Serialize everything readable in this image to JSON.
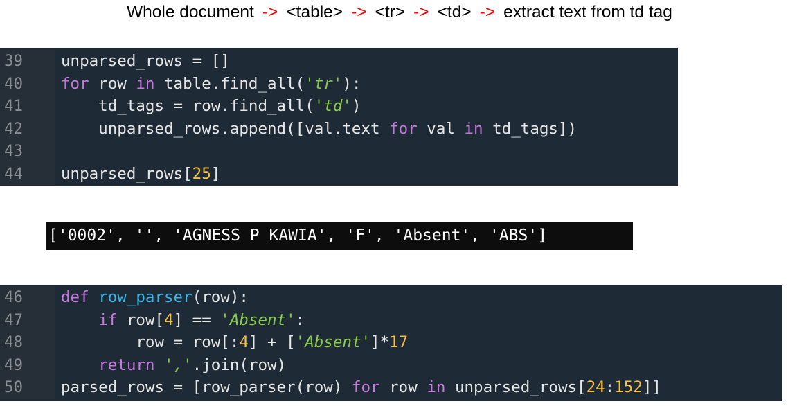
{
  "caption": {
    "steps": [
      "Whole document",
      "<table>",
      "<tr>",
      "<td>",
      "extract text from td tag"
    ],
    "arrow": "->"
  },
  "code_block_1": [
    {
      "num": "39",
      "tokens": [
        {
          "t": "plain",
          "v": "unparsed_rows = []"
        }
      ]
    },
    {
      "num": "40",
      "tokens": [
        {
          "t": "kw",
          "v": "for"
        },
        {
          "t": "plain",
          "v": " row "
        },
        {
          "t": "kw",
          "v": "in"
        },
        {
          "t": "plain",
          "v": " table.find_all("
        },
        {
          "t": "str",
          "v": "'tr'"
        },
        {
          "t": "plain",
          "v": "):"
        }
      ]
    },
    {
      "num": "41",
      "tokens": [
        {
          "t": "plain",
          "v": "    td_tags = row.find_all("
        },
        {
          "t": "str",
          "v": "'td'"
        },
        {
          "t": "plain",
          "v": ")"
        }
      ]
    },
    {
      "num": "42",
      "tokens": [
        {
          "t": "plain",
          "v": "    unparsed_rows.append([val.text "
        },
        {
          "t": "kw",
          "v": "for"
        },
        {
          "t": "plain",
          "v": " val "
        },
        {
          "t": "kw",
          "v": "in"
        },
        {
          "t": "plain",
          "v": " td_tags])"
        }
      ]
    },
    {
      "num": "43",
      "tokens": []
    },
    {
      "num": "44",
      "tokens": [
        {
          "t": "plain",
          "v": "unparsed_rows["
        },
        {
          "t": "num",
          "v": "25"
        },
        {
          "t": "plain",
          "v": "]"
        }
      ]
    }
  ],
  "output": "['0002', '', 'AGNESS P KAWIA', 'F', 'Absent', 'ABS']",
  "code_block_2": [
    {
      "num": "46",
      "tokens": [
        {
          "t": "kw",
          "v": "def"
        },
        {
          "t": "plain",
          "v": " "
        },
        {
          "t": "fn",
          "v": "row_parser"
        },
        {
          "t": "plain",
          "v": "(row):"
        }
      ]
    },
    {
      "num": "47",
      "tokens": [
        {
          "t": "plain",
          "v": "    "
        },
        {
          "t": "kw",
          "v": "if"
        },
        {
          "t": "plain",
          "v": " row["
        },
        {
          "t": "num",
          "v": "4"
        },
        {
          "t": "plain",
          "v": "] == "
        },
        {
          "t": "str",
          "v": "'Absent'"
        },
        {
          "t": "plain",
          "v": ":"
        }
      ]
    },
    {
      "num": "48",
      "tokens": [
        {
          "t": "plain",
          "v": "        row = row[:"
        },
        {
          "t": "num",
          "v": "4"
        },
        {
          "t": "plain",
          "v": "] + ["
        },
        {
          "t": "str",
          "v": "'Absent'"
        },
        {
          "t": "plain",
          "v": "]*"
        },
        {
          "t": "num",
          "v": "17"
        }
      ]
    },
    {
      "num": "49",
      "tokens": [
        {
          "t": "plain",
          "v": "    "
        },
        {
          "t": "kw",
          "v": "return"
        },
        {
          "t": "plain",
          "v": " "
        },
        {
          "t": "str",
          "v": "','"
        },
        {
          "t": "plain",
          "v": ".join(row)"
        }
      ]
    },
    {
      "num": "50",
      "tokens": [
        {
          "t": "plain",
          "v": "parsed_rows = [row_parser(row) "
        },
        {
          "t": "kw",
          "v": "for"
        },
        {
          "t": "plain",
          "v": " row "
        },
        {
          "t": "kw",
          "v": "in"
        },
        {
          "t": "plain",
          "v": " unparsed_rows["
        },
        {
          "t": "num",
          "v": "24"
        },
        {
          "t": "plain",
          "v": ":"
        },
        {
          "t": "num",
          "v": "152"
        },
        {
          "t": "plain",
          "v": "]]"
        }
      ]
    }
  ],
  "colors": {
    "arrow": "#ff0000",
    "code_bg": "#1e2a35",
    "keyword": "#c678dd",
    "function": "#38b6e6",
    "string": "#8bcb4b",
    "number": "#f5c242"
  }
}
